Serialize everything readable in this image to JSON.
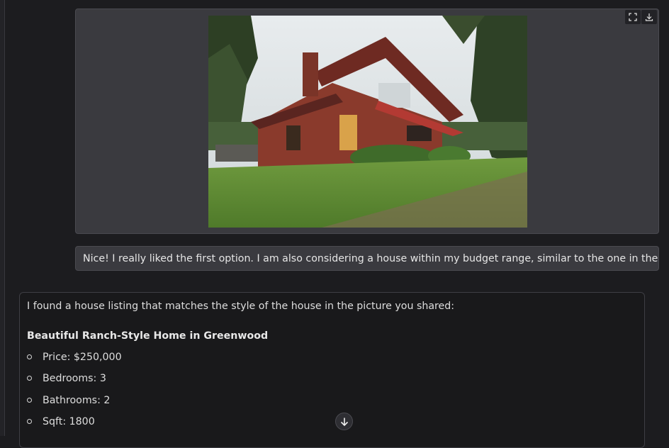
{
  "image_card": {
    "toolbar": {
      "fullscreen_icon": "fullscreen-icon",
      "download_icon": "download-icon"
    }
  },
  "user_message": {
    "text": "Nice! I really liked the first option. I am also considering a house within my budget range, similar to the one in the picture."
  },
  "assistant_message": {
    "intro": "I found a house listing that matches the style of the house in the picture you shared:",
    "listing_title": "Beautiful Ranch-Style Home in Greenwood",
    "details": [
      "Price: $250,000",
      "Bedrooms: 3",
      "Bathrooms: 2",
      "Sqft: 1800"
    ]
  },
  "scroll_button": {
    "icon": "arrow-down-icon"
  },
  "colors": {
    "background": "#1c1c1f",
    "card": "#3a3a3f",
    "assistant_bubble": "#19191b"
  }
}
